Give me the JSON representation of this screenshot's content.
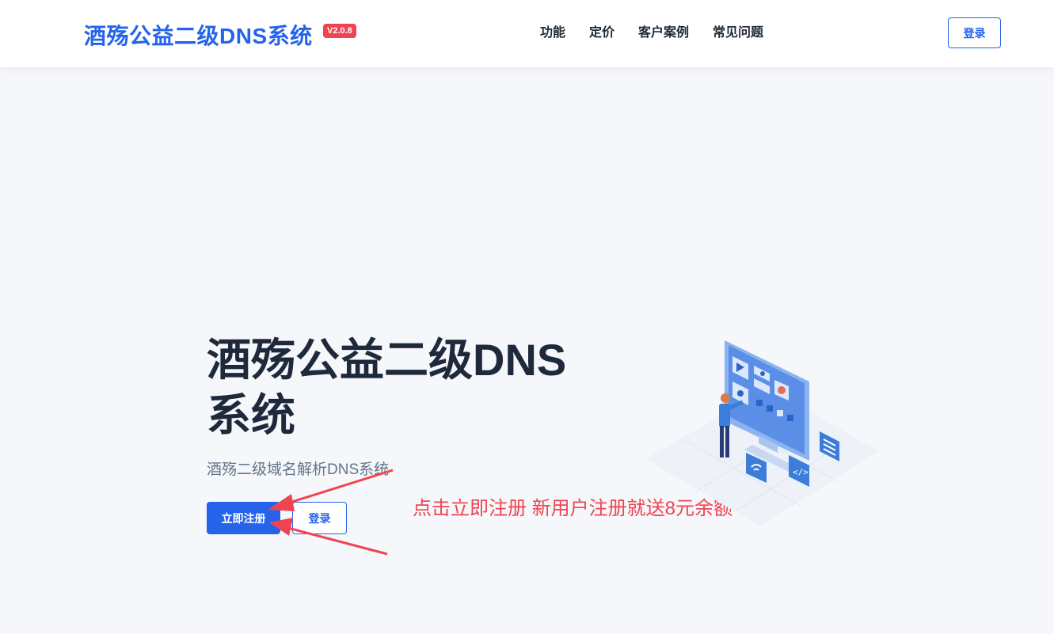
{
  "header": {
    "brand": "酒殇公益二级DNS系统",
    "version": "V2.0.8",
    "nav": [
      {
        "label": "功能"
      },
      {
        "label": "定价"
      },
      {
        "label": "客户案例"
      },
      {
        "label": "常见问题"
      }
    ],
    "login_label": "登录"
  },
  "hero": {
    "title": "酒殇公益二级DNS系统",
    "subtitle": "酒殇二级域名解析DNS系统",
    "register_label": "立即注册",
    "login_label": "登录"
  },
  "annotation": {
    "text": "点击立即注册 新用户注册就送8元余额",
    "color": "#ef4452"
  },
  "colors": {
    "accent": "#2563eb",
    "badge": "#ef4452",
    "background": "#f5f7fa"
  }
}
